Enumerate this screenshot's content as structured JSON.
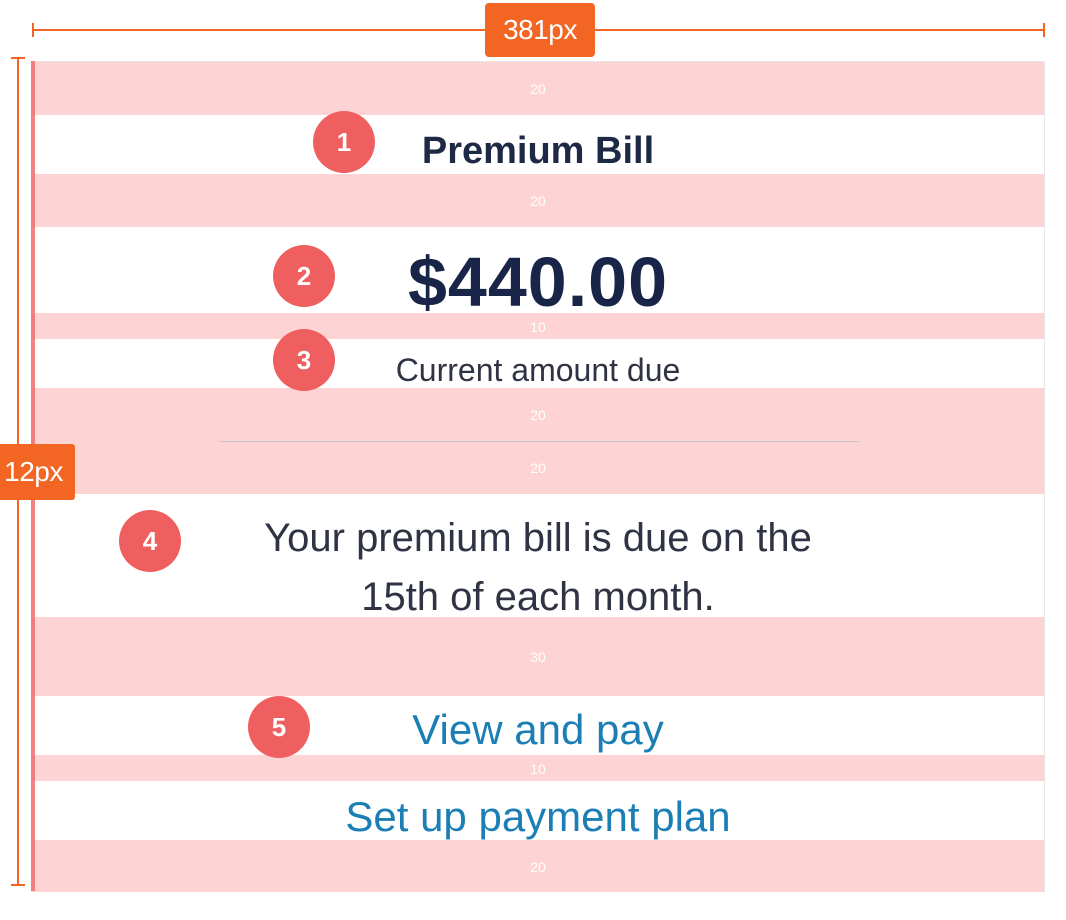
{
  "dimensions": {
    "width_label": "381px",
    "height_label": "12px"
  },
  "spacing_labels": {
    "top": "20",
    "after_title": "20",
    "after_amount": "10",
    "before_divider": "20",
    "after_divider": "20",
    "after_message": "30",
    "between_links": "10",
    "bottom": "20"
  },
  "card": {
    "title": "Premium Bill",
    "amount": "$440.00",
    "amount_caption": "Current amount due",
    "message_line1": "Your premium bill is due on the",
    "message_line2": "15th of each month.",
    "primary_link": "View and pay",
    "secondary_link": "Set up payment plan"
  },
  "markers": [
    "1",
    "2",
    "3",
    "4",
    "5"
  ],
  "colors": {
    "accent_orange": "#f26522",
    "spacing_band": "#fdd3d3",
    "marker_red": "#f05f5f",
    "link_blue": "#1b7eb4",
    "title_navy": "#1e2a45"
  }
}
